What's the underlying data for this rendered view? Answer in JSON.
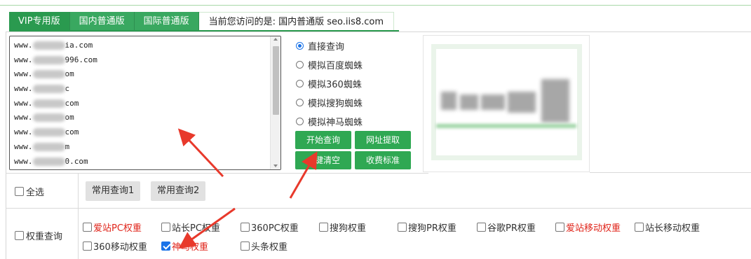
{
  "tabs": {
    "vip": "VIP专用版",
    "domestic": "国内普通版",
    "international": "国际普通版",
    "current_info": "当前您访问的是: 国内普通版 seo.iis8.com"
  },
  "url_list": [
    {
      "prefix": "www.",
      "suffix": "ia.com"
    },
    {
      "prefix": "www.",
      "suffix": "996.com"
    },
    {
      "prefix": "www.",
      "suffix": "om"
    },
    {
      "prefix": "www.",
      "suffix": "c"
    },
    {
      "prefix": "www.",
      "suffix": "com"
    },
    {
      "prefix": "www.",
      "suffix": "om"
    },
    {
      "prefix": "www.",
      "suffix": "com"
    },
    {
      "prefix": "www.",
      "suffix": "m"
    },
    {
      "prefix": "www.",
      "suffix": "0.com"
    }
  ],
  "modes": [
    {
      "label": "直接查询",
      "checked": true
    },
    {
      "label": "模拟百度蜘蛛",
      "checked": false
    },
    {
      "label": "模拟360蜘蛛",
      "checked": false
    },
    {
      "label": "模拟搜狗蜘蛛",
      "checked": false
    },
    {
      "label": "模拟神马蜘蛛",
      "checked": false
    }
  ],
  "buttons": {
    "start": "开始查询",
    "extract": "网址提取",
    "clear": "一键清空",
    "pricing": "收费标准"
  },
  "select_all": {
    "label": "全选",
    "checked": false,
    "common1": "常用查询1",
    "common2": "常用查询2"
  },
  "weight": {
    "label": "权重查询",
    "checked": false,
    "options": [
      {
        "label": "爱站PC权重",
        "checked": false,
        "highlight": true
      },
      {
        "label": "站长PC权重",
        "checked": false,
        "highlight": false
      },
      {
        "label": "360PC权重",
        "checked": false,
        "highlight": false
      },
      {
        "label": "搜狗权重",
        "checked": false,
        "highlight": false
      },
      {
        "label": "搜狗PR权重",
        "checked": false,
        "highlight": false
      },
      {
        "label": "谷歌PR权重",
        "checked": false,
        "highlight": false
      },
      {
        "label": "爱站移动权重",
        "checked": false,
        "highlight": true
      },
      {
        "label": "站长移动权重",
        "checked": false,
        "highlight": false
      },
      {
        "label": "360移动权重",
        "checked": false,
        "highlight": false
      },
      {
        "label": "神马权重",
        "checked": true,
        "highlight": true
      },
      {
        "label": "头条权重",
        "checked": false,
        "highlight": false
      }
    ]
  },
  "colors": {
    "brand_green": "#2fa853",
    "highlight_red": "#e0251b",
    "annotation_arrow": "#e8392b"
  }
}
